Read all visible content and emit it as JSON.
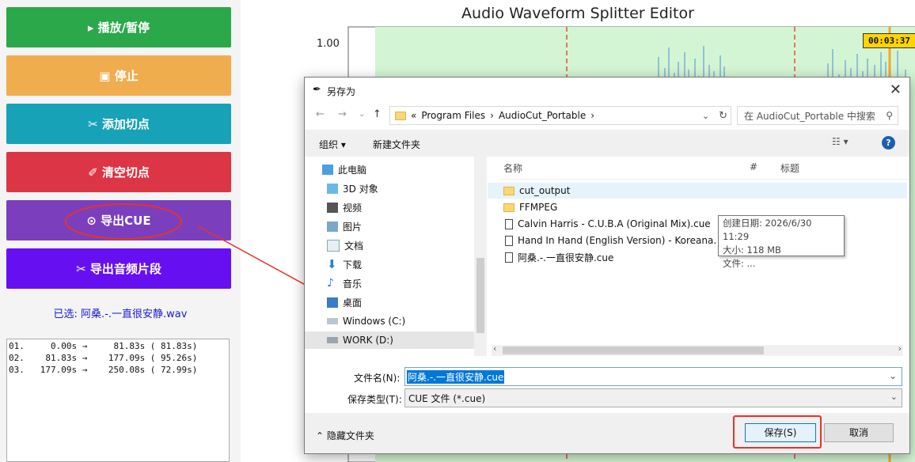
{
  "left_panel": {
    "buttons": [
      {
        "label": "▸ 播放/暂停",
        "color": "#2ba84a"
      },
      {
        "label": "▣ 停止",
        "color": "#f0ad4e"
      },
      {
        "label": "✂ 添加切点",
        "color": "#17a2b8"
      },
      {
        "label": "✐ 清空切点",
        "color": "#dc3545"
      },
      {
        "label": "⊙ 导出CUE",
        "color": "#7b3fbe"
      },
      {
        "label": "✂ 导出音频片段",
        "color": "#6610f2"
      }
    ],
    "selected_text": "已选:    阿桑.-.一直很安静.wav",
    "segments": [
      "01.     0.00s →     81.83s ( 81.83s)",
      "02.    81.83s →    177.09s ( 95.26s)",
      "03.   177.09s →    250.08s ( 72.99s)"
    ]
  },
  "chart": {
    "title": "Audio Waveform Splitter Editor",
    "y_tick": "1.00",
    "time_label": "00:03:37",
    "colors": {
      "region": "#d4f5d4",
      "cut_line": "#e74c3c",
      "waveform": "#4a90d9",
      "playhead": "#f5a623"
    }
  },
  "dialog": {
    "title": "另存为",
    "path": [
      "«",
      "Program Files",
      "›",
      "AudioCut_Portable",
      "›"
    ],
    "search_placeholder": "在 AudioCut_Portable 中搜索",
    "toolbar": {
      "organize": "组织 ▾",
      "new_folder": "新建文件夹"
    },
    "tree": [
      {
        "label": "此电脑",
        "icon": "computer-icon"
      },
      {
        "label": "3D 对象",
        "icon": "cube-icon"
      },
      {
        "label": "视频",
        "icon": "video-icon"
      },
      {
        "label": "图片",
        "icon": "picture-icon"
      },
      {
        "label": "文档",
        "icon": "document-icon"
      },
      {
        "label": "下载",
        "icon": "download-icon"
      },
      {
        "label": "音乐",
        "icon": "music-icon"
      },
      {
        "label": "桌面",
        "icon": "desktop-icon"
      },
      {
        "label": "Windows (C:)",
        "icon": "drive-icon"
      },
      {
        "label": "WORK (D:)",
        "icon": "drive-icon"
      }
    ],
    "columns": {
      "name": "名称",
      "number": "#",
      "title": "标题"
    },
    "files": [
      {
        "name": "cut_output",
        "type": "folder"
      },
      {
        "name": "FFMPEG",
        "type": "folder"
      },
      {
        "name": "Calvin Harris - C.U.B.A (Original Mix).cue",
        "type": "cue"
      },
      {
        "name": "Hand In Hand (English Version) - Koreana.",
        "type": "cue"
      },
      {
        "name": "阿桑.-.一直很安静.cue",
        "type": "cue"
      }
    ],
    "tooltip": {
      "created": "创建日期: 2026/6/30 11:29",
      "size": "大小: 118 MB",
      "file": "文件: ..."
    },
    "filename_label": "文件名(N):",
    "filename_value": "阿桑.-.一直很安静.cue",
    "filetype_label": "保存类型(T):",
    "filetype_value": "CUE 文件 (*.cue)",
    "hide_folders": "隐藏文件夹",
    "save_label": "保存(S)",
    "cancel_label": "取消"
  }
}
